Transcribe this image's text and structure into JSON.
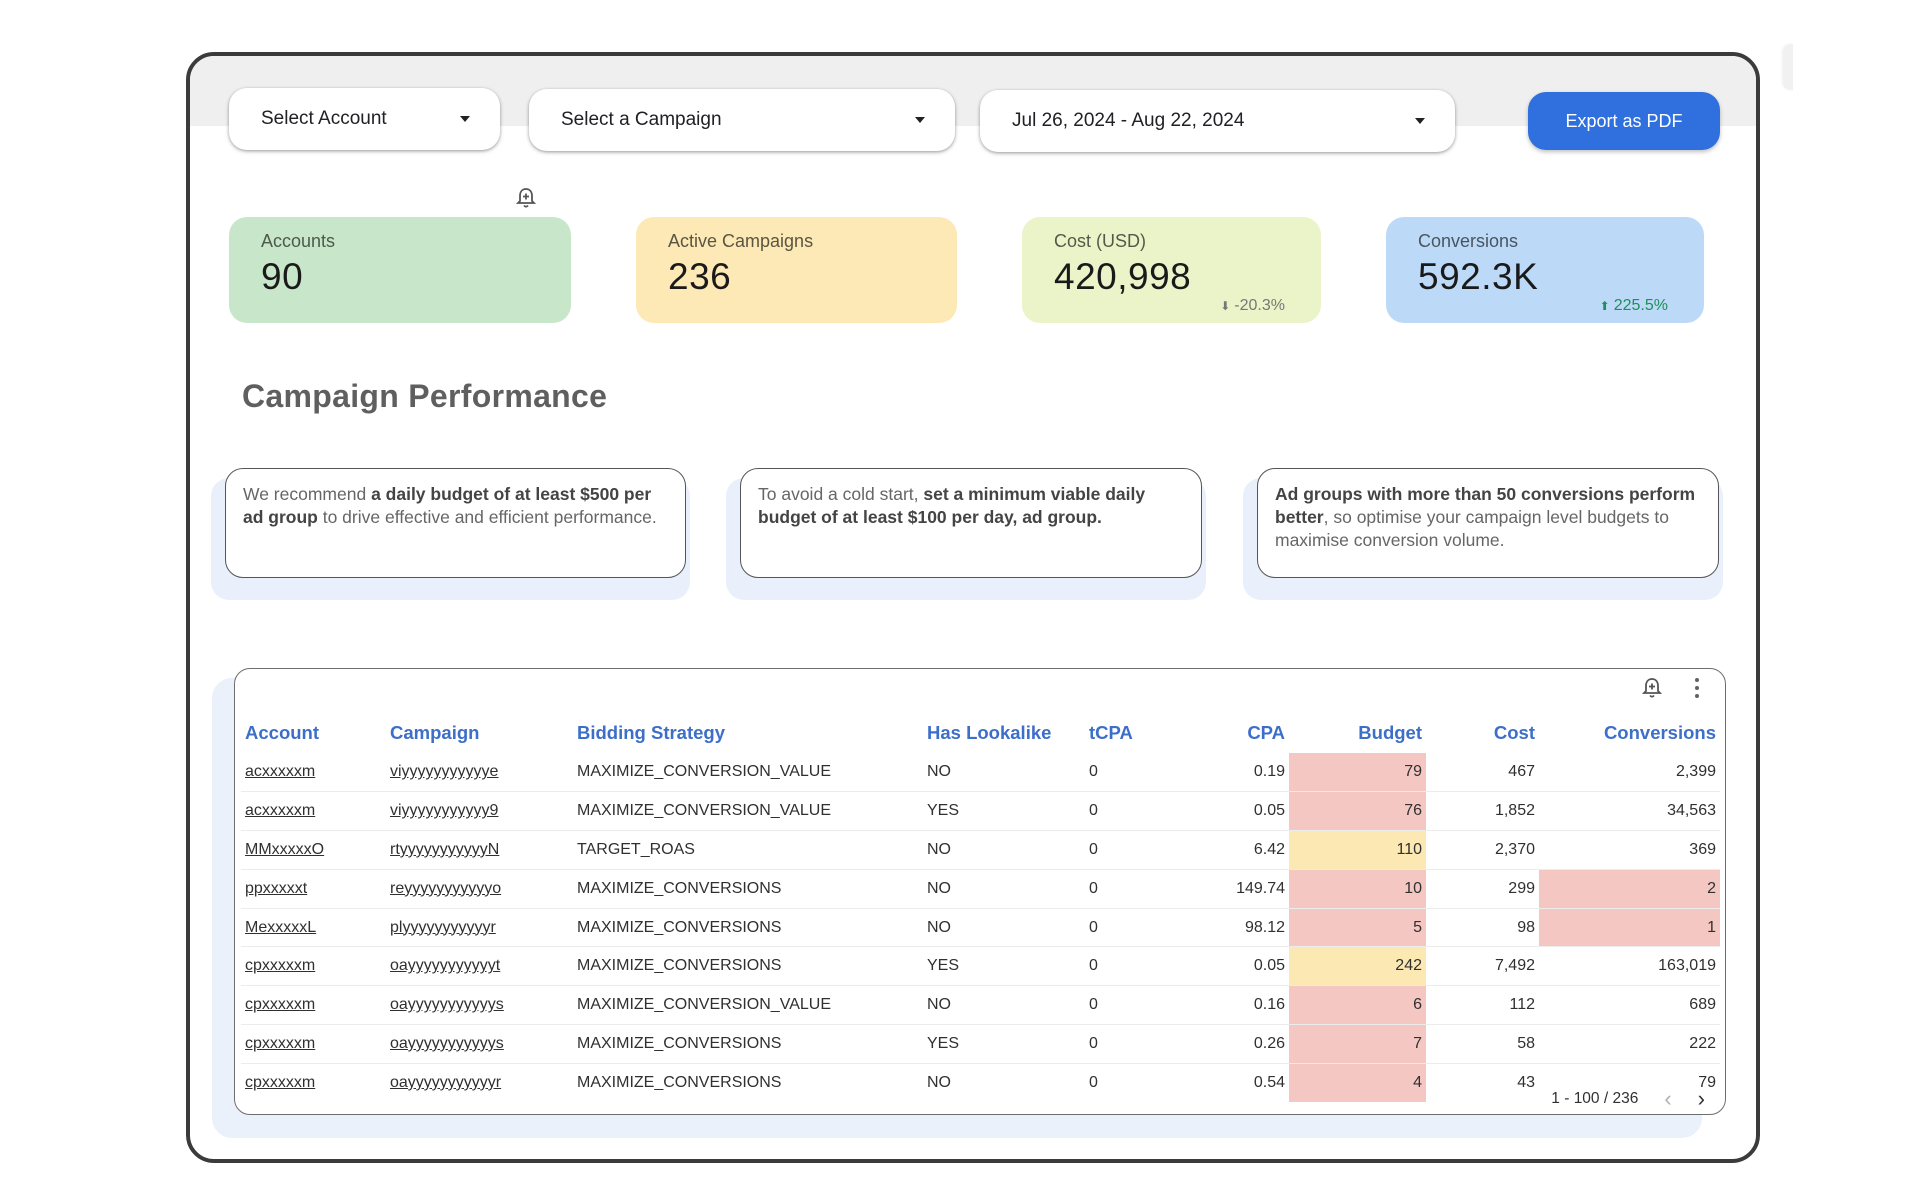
{
  "filters": {
    "account": {
      "label": "Select Account"
    },
    "campaign": {
      "label": "Select a Campaign"
    },
    "date_range": {
      "label": "Jul 26, 2024 - Aug 22, 2024"
    }
  },
  "toolbar": {
    "export_label": "Export as PDF"
  },
  "colors": {
    "accent": "#2f6fde",
    "kpi_accounts_bg": "#c8e6c9",
    "kpi_campaigns_bg": "#fde9b5",
    "kpi_cost_bg": "#eaf4c8",
    "kpi_conversions_bg": "#bcdaf7",
    "highlight_red": "#f4c7c3",
    "highlight_yellow": "#fce8b2",
    "header_text": "#3d6fc9"
  },
  "kpis": [
    {
      "label": "Accounts",
      "value": "90",
      "delta": null
    },
    {
      "label": "Active Campaigns",
      "value": "236",
      "delta": null
    },
    {
      "label": "Cost (USD)",
      "value": "420,998",
      "delta": "-20.3%",
      "delta_direction": "down"
    },
    {
      "label": "Conversions",
      "value": "592.3K",
      "delta": "225.5%",
      "delta_direction": "up"
    }
  ],
  "section": {
    "title": "Campaign Performance"
  },
  "recommendations": [
    {
      "pre": "We recommend ",
      "bold": "a daily budget of at least $500 per ad group",
      "post": " to drive effective and efficient performance."
    },
    {
      "pre": "To avoid a cold start, ",
      "bold": "set a minimum viable daily budget of at least $100 per day, ad group.",
      "post": ""
    },
    {
      "pre": "",
      "bold": "Ad groups with more than 50 conversions perform better",
      "post": ", so optimise your campaign level budgets to maximise conversion volume."
    }
  ],
  "table": {
    "columns": [
      "Account",
      "Campaign",
      "Bidding Strategy",
      "Has Lookalike",
      "tCPA",
      "CPA",
      "Budget",
      "Cost",
      "Conversions"
    ],
    "rows": [
      {
        "account": "acxxxxxm",
        "campaign": "viyyyyyyyyyyye",
        "bidding": "MAXIMIZE_CONVERSION_VALUE",
        "lookalike": "NO",
        "tcpa": "0",
        "cpa": "0.19",
        "budget": "79",
        "budget_flag": "red",
        "cost": "467",
        "conversions": "2,399",
        "conv_flag": ""
      },
      {
        "account": "acxxxxxm",
        "campaign": "viyyyyyyyyyyy9",
        "bidding": "MAXIMIZE_CONVERSION_VALUE",
        "lookalike": "YES",
        "tcpa": "0",
        "cpa": "0.05",
        "budget": "76",
        "budget_flag": "red",
        "cost": "1,852",
        "conversions": "34,563",
        "conv_flag": ""
      },
      {
        "account": "MMxxxxxO",
        "campaign": "rtyyyyyyyyyyyN",
        "bidding": "TARGET_ROAS",
        "lookalike": "NO",
        "tcpa": "0",
        "cpa": "6.42",
        "budget": "110",
        "budget_flag": "yellow",
        "cost": "2,370",
        "conversions": "369",
        "conv_flag": ""
      },
      {
        "account": "ppxxxxxt",
        "campaign": "reyyyyyyyyyyyo",
        "bidding": "MAXIMIZE_CONVERSIONS",
        "lookalike": "NO",
        "tcpa": "0",
        "cpa": "149.74",
        "budget": "10",
        "budget_flag": "red",
        "cost": "299",
        "conversions": "2",
        "conv_flag": "red"
      },
      {
        "account": "MexxxxxL",
        "campaign": "plyyyyyyyyyyyr",
        "bidding": "MAXIMIZE_CONVERSIONS",
        "lookalike": "NO",
        "tcpa": "0",
        "cpa": "98.12",
        "budget": "5",
        "budget_flag": "red",
        "cost": "98",
        "conversions": "1",
        "conv_flag": "red"
      },
      {
        "account": "cpxxxxxm",
        "campaign": "oayyyyyyyyyyyt",
        "bidding": "MAXIMIZE_CONVERSIONS",
        "lookalike": "YES",
        "tcpa": "0",
        "cpa": "0.05",
        "budget": "242",
        "budget_flag": "yellow",
        "cost": "7,492",
        "conversions": "163,019",
        "conv_flag": ""
      },
      {
        "account": "cpxxxxxm",
        "campaign": "oayyyyyyyyyyys",
        "bidding": "MAXIMIZE_CONVERSION_VALUE",
        "lookalike": "NO",
        "tcpa": "0",
        "cpa": "0.16",
        "budget": "6",
        "budget_flag": "red",
        "cost": "112",
        "conversions": "689",
        "conv_flag": ""
      },
      {
        "account": "cpxxxxxm",
        "campaign": "oayyyyyyyyyyys",
        "bidding": "MAXIMIZE_CONVERSIONS",
        "lookalike": "YES",
        "tcpa": "0",
        "cpa": "0.26",
        "budget": "7",
        "budget_flag": "red",
        "cost": "58",
        "conversions": "222",
        "conv_flag": ""
      },
      {
        "account": "cpxxxxxm",
        "campaign": "oayyyyyyyyyyyr",
        "bidding": "MAXIMIZE_CONVERSIONS",
        "lookalike": "NO",
        "tcpa": "0",
        "cpa": "0.54",
        "budget": "4",
        "budget_flag": "red",
        "cost": "43",
        "conversions": "79",
        "conv_flag": ""
      }
    ],
    "pagination": {
      "label": "1 - 100 / 236",
      "prev_icon": "chevron-left",
      "next_icon": "chevron-right"
    }
  },
  "icons": {
    "alert": "bell-plus-icon",
    "menu": "more-vert-icon"
  }
}
